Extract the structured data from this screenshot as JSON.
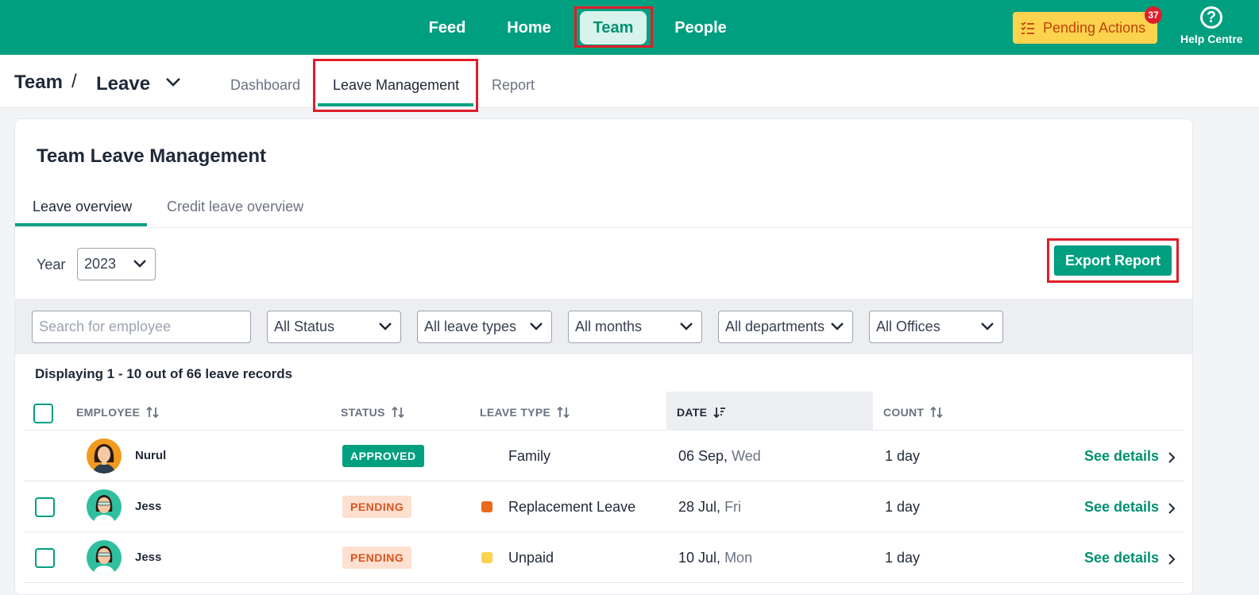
{
  "topnav": {
    "items": [
      {
        "label": "Feed"
      },
      {
        "label": "Home"
      },
      {
        "label": "Team"
      },
      {
        "label": "People"
      }
    ],
    "pending_actions": {
      "label": "Pending Actions",
      "badge": "37"
    },
    "help": {
      "label": "Help Centre"
    }
  },
  "breadcrumb": {
    "root": "Team",
    "separator": "/",
    "current": "Leave"
  },
  "subtabs": [
    {
      "label": "Dashboard"
    },
    {
      "label": "Leave Management"
    },
    {
      "label": "Report"
    }
  ],
  "card": {
    "title": "Team Leave Management",
    "tabs": [
      {
        "label": "Leave overview"
      },
      {
        "label": "Credit leave overview"
      }
    ],
    "year": {
      "label": "Year",
      "value": "2023"
    },
    "export_label": "Export Report",
    "filters": {
      "search_placeholder": "Search for employee",
      "status": "All Status",
      "leave_types": "All leave types",
      "months": "All months",
      "departments": "All departments",
      "offices": "All Offices"
    },
    "records_text": "Displaying 1 - 10 out of 66 leave records"
  },
  "table": {
    "headers": {
      "employee": "EMPLOYEE",
      "status": "STATUS",
      "leave_type": "LEAVE TYPE",
      "date": "DATE",
      "count": "COUNT"
    },
    "rows": [
      {
        "name": "Nurul",
        "status": "APPROVED",
        "leave_type": "Family",
        "date": "06 Sep,",
        "dow": "Wed",
        "count": "1 day",
        "action": "See details"
      },
      {
        "name": "Jess",
        "status": "PENDING",
        "leave_type": "Replacement Leave",
        "date": "28 Jul,",
        "dow": "Fri",
        "count": "1 day",
        "action": "See details"
      },
      {
        "name": "Jess",
        "status": "PENDING",
        "leave_type": "Unpaid",
        "date": "10 Jul,",
        "dow": "Mon",
        "count": "1 day",
        "action": "See details"
      }
    ]
  },
  "colors": {
    "brand": "#009f80",
    "highlight": "#e11d2a",
    "replacement_leave_dot": "#ea6a1a",
    "unpaid_dot": "#fcd34d"
  }
}
